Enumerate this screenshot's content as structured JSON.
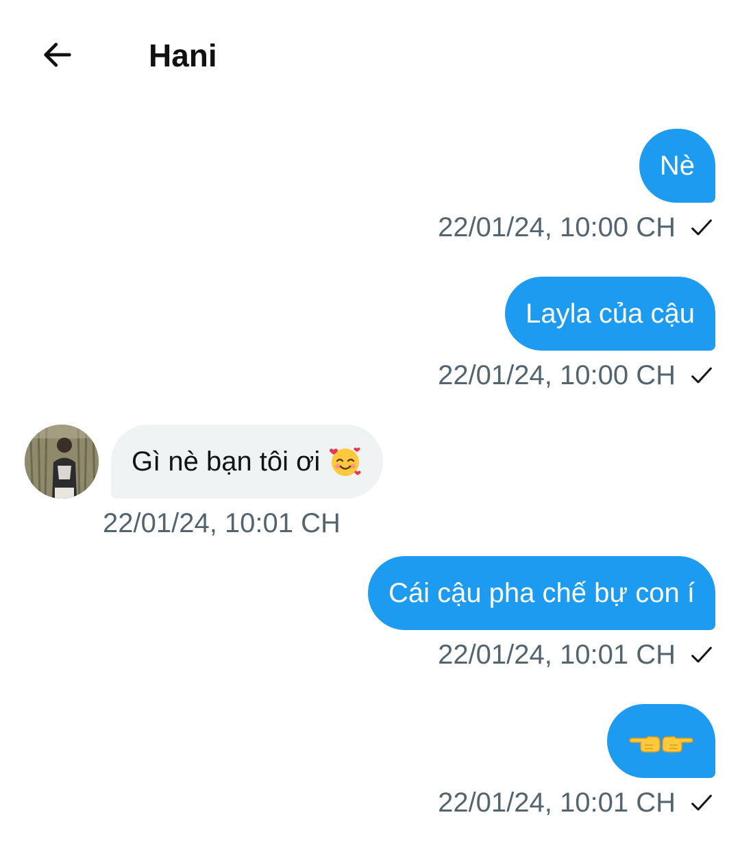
{
  "header": {
    "title": "Hani",
    "back_icon": "arrow-left-icon"
  },
  "messages": [
    {
      "direction": "sent",
      "text": "Nè",
      "time": "22/01/24, 10:00 CH",
      "status_icon": "check-icon"
    },
    {
      "direction": "sent",
      "text": "Layla của cậu",
      "time": "22/01/24, 10:00 CH",
      "status_icon": "check-icon"
    },
    {
      "direction": "received",
      "text": "Gì nè bạn tôi ơi",
      "emoji": "smiling-face-with-hearts-icon",
      "time": "22/01/24, 10:01 CH"
    },
    {
      "direction": "sent",
      "text": "Cái cậu pha chế bự con í",
      "time": "22/01/24, 10:01 CH",
      "status_icon": "check-icon"
    },
    {
      "direction": "sent",
      "text": "",
      "emoji": "pointing-hands-icon",
      "time": "22/01/24, 10:01 CH",
      "status_icon": "check-icon"
    }
  ],
  "colors": {
    "sent_bubble": "#1d9bf0",
    "received_bubble": "#eff3f4",
    "timestamp": "#536471"
  }
}
